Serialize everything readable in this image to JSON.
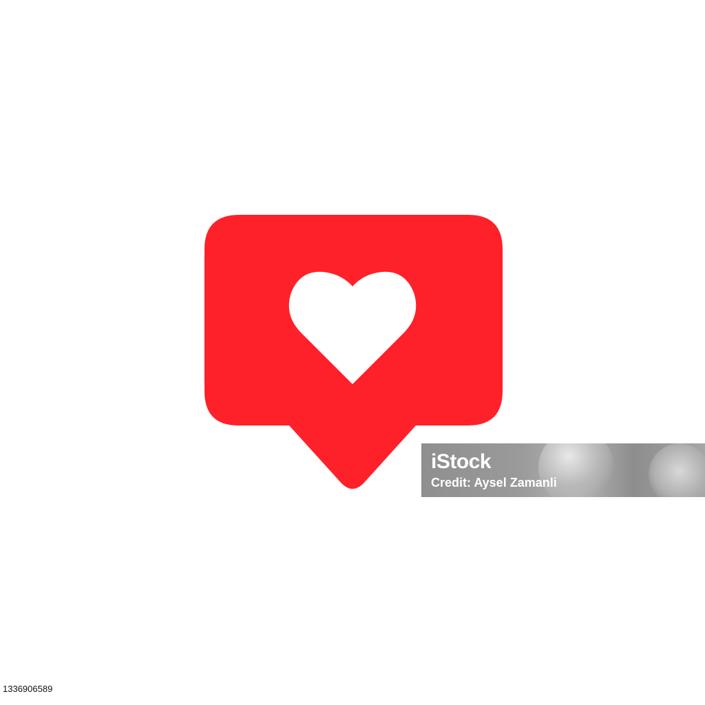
{
  "icon": {
    "name": "like-notification-icon",
    "bubble_color": "#fe212a",
    "heart_color": "#ffffff"
  },
  "watermark": {
    "brand": "iStock",
    "credit": "Credit: Aysel Zamanli"
  },
  "footer": {
    "image_id": "1336906589"
  }
}
